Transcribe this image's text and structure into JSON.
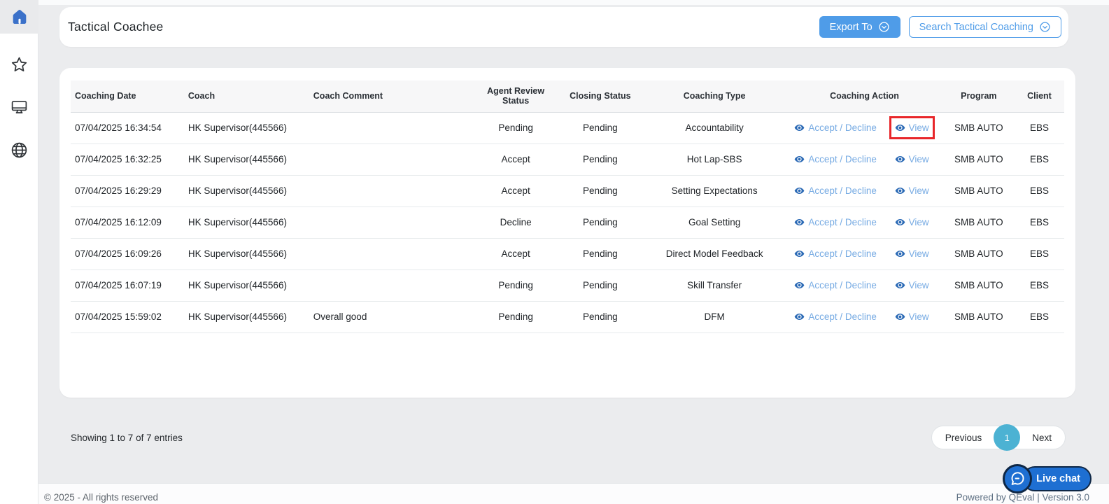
{
  "sidebar": {
    "items": [
      {
        "name": "home",
        "active": true
      },
      {
        "name": "star",
        "active": false
      },
      {
        "name": "monitor",
        "active": false
      },
      {
        "name": "globe",
        "active": false
      }
    ]
  },
  "header": {
    "title": "Tactical Coachee",
    "export_button": "Export To",
    "search_button": "Search Tactical Coaching"
  },
  "table": {
    "columns": [
      "Coaching Date",
      "Coach",
      "Coach Comment",
      "Agent Review Status",
      "Closing Status",
      "Coaching Type",
      "Coaching Action",
      "Program",
      "Client"
    ],
    "action_labels": {
      "accept_decline": "Accept / Decline",
      "view": "View"
    },
    "rows": [
      {
        "coaching_date": "07/04/2025 16:34:54",
        "coach": "HK Supervisor(445566)",
        "coach_comment": "",
        "agent_review_status": "Pending",
        "closing_status": "Pending",
        "coaching_type": "Accountability",
        "program": "SMB AUTO",
        "client": "EBS",
        "view_highlighted": true
      },
      {
        "coaching_date": "07/04/2025 16:32:25",
        "coach": "HK Supervisor(445566)",
        "coach_comment": "",
        "agent_review_status": "Accept",
        "closing_status": "Pending",
        "coaching_type": "Hot Lap-SBS",
        "program": "SMB AUTO",
        "client": "EBS",
        "view_highlighted": false
      },
      {
        "coaching_date": "07/04/2025 16:29:29",
        "coach": "HK Supervisor(445566)",
        "coach_comment": "",
        "agent_review_status": "Accept",
        "closing_status": "Pending",
        "coaching_type": "Setting Expectations",
        "program": "SMB AUTO",
        "client": "EBS",
        "view_highlighted": false
      },
      {
        "coaching_date": "07/04/2025 16:12:09",
        "coach": "HK Supervisor(445566)",
        "coach_comment": "",
        "agent_review_status": "Decline",
        "closing_status": "Pending",
        "coaching_type": "Goal Setting",
        "program": "SMB AUTO",
        "client": "EBS",
        "view_highlighted": false
      },
      {
        "coaching_date": "07/04/2025 16:09:26",
        "coach": "HK Supervisor(445566)",
        "coach_comment": "",
        "agent_review_status": "Accept",
        "closing_status": "Pending",
        "coaching_type": "Direct Model Feedback",
        "program": "SMB AUTO",
        "client": "EBS",
        "view_highlighted": false
      },
      {
        "coaching_date": "07/04/2025 16:07:19",
        "coach": "HK Supervisor(445566)",
        "coach_comment": "",
        "agent_review_status": "Pending",
        "closing_status": "Pending",
        "coaching_type": "Skill Transfer",
        "program": "SMB AUTO",
        "client": "EBS",
        "view_highlighted": false
      },
      {
        "coaching_date": "07/04/2025 15:59:02",
        "coach": "HK Supervisor(445566)",
        "coach_comment": "Overall good",
        "agent_review_status": "Pending",
        "closing_status": "Pending",
        "coaching_type": "DFM",
        "program": "SMB AUTO",
        "client": "EBS",
        "view_highlighted": false
      }
    ],
    "summary": "Showing 1 to 7 of 7 entries"
  },
  "pagination": {
    "previous": "Previous",
    "current_page": "1",
    "next": "Next"
  },
  "footer": {
    "copyright": "© 2025 - All rights reserved",
    "powered": "Powered by QEval | Version 3.0"
  },
  "live_chat": {
    "label": "Live chat"
  },
  "colors": {
    "accent_blue": "#4f9ce8",
    "link_blue": "#77abe3",
    "eye_icon_blue": "#2a69b5",
    "status_pending": "#dd5a78",
    "status_accept": "#3fa065",
    "status_decline": "#d94760",
    "pagination_active": "#4cb2d3",
    "highlight_red": "#e8262a",
    "live_chat_blue": "#1e6fd2"
  }
}
